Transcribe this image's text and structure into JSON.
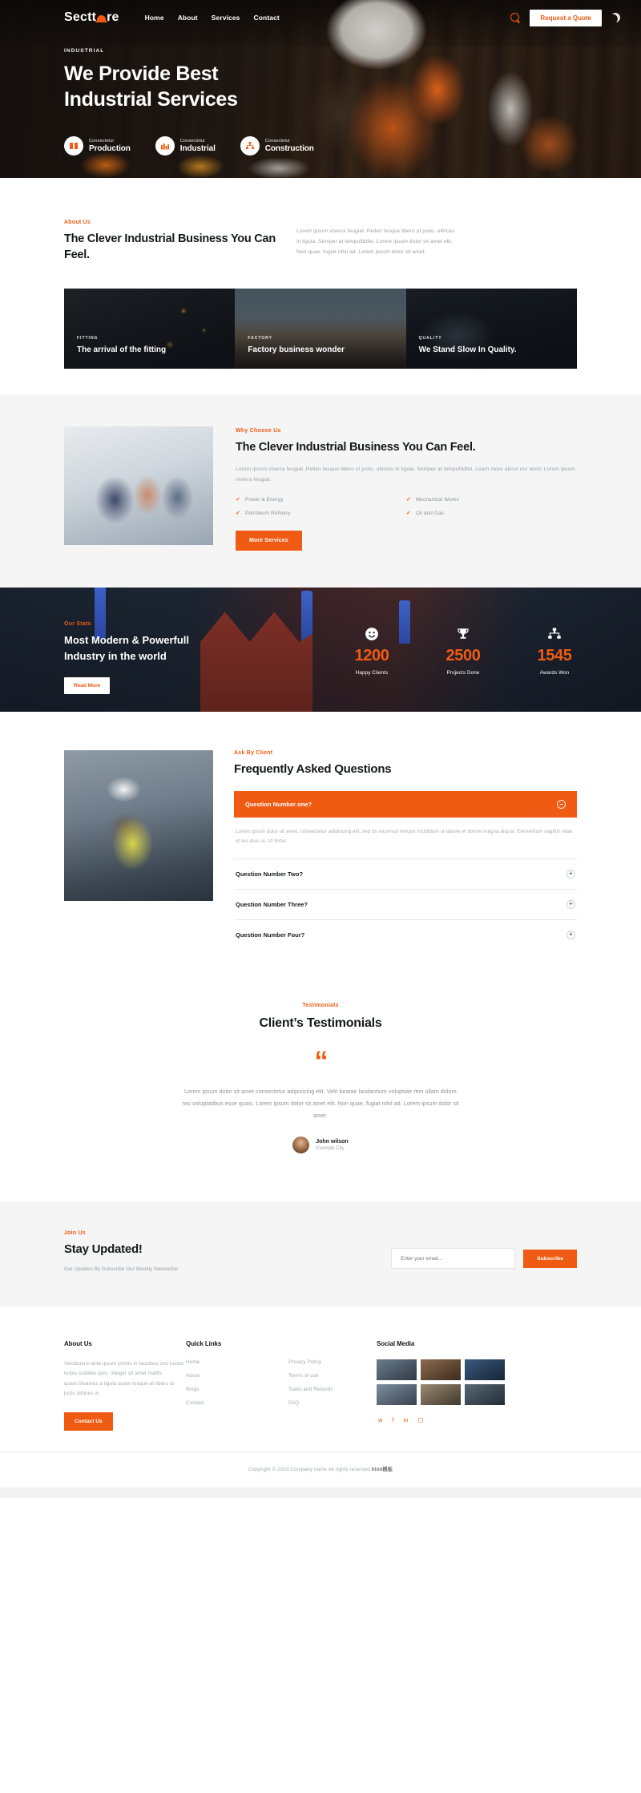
{
  "header": {
    "logo_text_1": "Sectt",
    "logo_text_2": "re",
    "nav": [
      {
        "label": "Home"
      },
      {
        "label": "About"
      },
      {
        "label": "Services"
      },
      {
        "label": "Contact"
      }
    ],
    "search_icon": "search-icon",
    "quote_button": "Request a Quote",
    "theme_toggle_icon": "moon-icon"
  },
  "hero": {
    "eyebrow": "INDUSTRIAL",
    "title_line1": "We Provide Best",
    "title_line2": "Industrial Services",
    "features": [
      {
        "icon": "box-icon",
        "sub": "Consectetur",
        "title": "Production"
      },
      {
        "icon": "factory-icon",
        "sub": "Consectetur",
        "title": "Industrial"
      },
      {
        "icon": "structure-icon",
        "sub": "Consectetur",
        "title": "Construction"
      }
    ]
  },
  "about": {
    "eyebrow": "About Us",
    "title": "The Clever Industrial Business You Can Feel.",
    "paragraph": "Lorem ipsum viverra feugiat. Pellen tesque libero ut justo, ultrices in ligula. Semper at tempufddfel. Lorem ipsum dolor sit amet elit. Non quae, fugiat nihil ad. Lorem ipsum dolor sit amet."
  },
  "cards": [
    {
      "eyebrow": "FITTING",
      "title": "The arrival of the fitting"
    },
    {
      "eyebrow": "FACTORY",
      "title": "Factory business wonder"
    },
    {
      "eyebrow": "QUALITY",
      "title": "We Stand Slow In Quality."
    }
  ],
  "why": {
    "eyebrow": "Why Choose Us",
    "title": "The Clever Industrial Business You Can Feel.",
    "paragraph": "Lorem ipsum viverra feugiat. Pellen tesque libero ut justo, ultrices in ligula. Semper at tempufddfel. Learn more about our work! Lorem ipsum viverra feugiat.",
    "checks": [
      "Power & Energy",
      "Mechanical Works",
      "Petroleum Refinery",
      "Oil and Gas"
    ],
    "button": "More Services"
  },
  "stats": {
    "eyebrow": "Our Stats",
    "title_line1": "Most Modern & Powerfull",
    "title_line2": "Industry in the world",
    "button": "Read More",
    "items": [
      {
        "icon": "smiley-icon",
        "number": "1200",
        "label": "Happy Clients"
      },
      {
        "icon": "trophy-icon",
        "number": "2500",
        "label": "Projects Done"
      },
      {
        "icon": "awards-icon",
        "number": "1545",
        "label": "Awards Won"
      }
    ]
  },
  "faq": {
    "eyebrow": "Ask By Client",
    "title": "Frequently Asked Questions",
    "open_question": "Question Number one?",
    "open_icon": "minus-circle-icon",
    "open_answer": "Lorem ipsum dolor sit amet, consectetur adipiscing elit, sed do eiusmod tempor incididunt ut labore et dolore magna aliqua. Elementum sagittis vitae et leo duis ut. Ut tortor.",
    "closed": [
      {
        "question": "Question Number Two?",
        "icon": "plus-circle-icon"
      },
      {
        "question": "Question Number Three?",
        "icon": "plus-circle-icon"
      },
      {
        "question": "Question Number Four?",
        "icon": "plus-circle-icon"
      }
    ]
  },
  "testimonials": {
    "eyebrow": "Testimonials",
    "title": "Client’s Testimonials",
    "quote_icon": "quote-icon",
    "quote": "Lorem ipsum dolor sit amet consectetur adipisicing elit. Velit beatae laudantium voluptate rem ullam dolore nisi voluptatibus esse quasi. Lorem ipsum dolor sit amet elit. Non quae, fugiat nihil ad. Lorem ipsum dolor sit amet.",
    "author_name": "John wilson",
    "author_role": "Example City"
  },
  "newsletter": {
    "eyebrow": "Join Us",
    "title": "Stay Updated!",
    "subtitle": "Get Updates By Subscribe Our Weekly Newsletter",
    "input_placeholder": "Enter your email...",
    "input_value": "",
    "button": "Subscribe"
  },
  "footer": {
    "about_heading": "About Us",
    "about_text": "Vestibulum ante ipsum primis in faucibus orci luctus turpis sodales quis. Integer sit amet mattis quam.Vivamus a ligula quam tesque et libero ut justo ultrices in.",
    "contact_button": "Contact Us",
    "quick_heading": "Quick Links",
    "quick_links_col1": [
      "Home",
      "About",
      "Blogs",
      "Contact"
    ],
    "quick_links_col2": [
      "Privacy Policy",
      "Terms of use",
      "Sales and Refunds",
      "FAQ"
    ],
    "social_heading": "Social Media",
    "social_icons": [
      "twitter-icon",
      "facebook-icon",
      "linkedin-icon",
      "instagram-icon"
    ],
    "copyright": "Copyright © 2023.Company name All rights reserved.",
    "copyright_bold": "html模板"
  },
  "colors": {
    "accent": "#ef5b13",
    "dark": "#16181c",
    "muted": "#a4a9af",
    "panel": "#f5f5f5"
  }
}
